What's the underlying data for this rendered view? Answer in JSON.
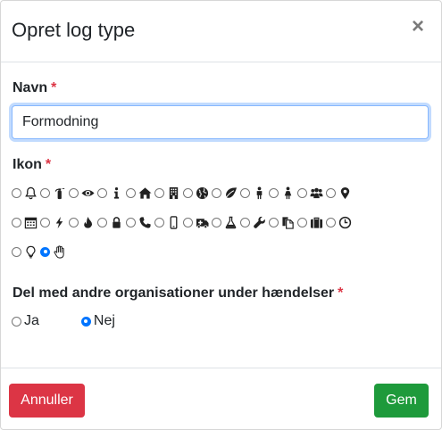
{
  "modal": {
    "title": "Opret log type",
    "close_label": "×"
  },
  "form": {
    "name_label": "Navn",
    "name_value": "Formodning",
    "icon_label": "Ikon",
    "required_mark": "*",
    "share_label": "Del med andre organisationer under hændelser",
    "share_options": [
      {
        "label": "Ja",
        "selected": false
      },
      {
        "label": "Nej",
        "selected": true
      }
    ]
  },
  "icons": [
    {
      "name": "bell-icon",
      "selected": false
    },
    {
      "name": "fire-extinguisher-icon",
      "selected": false
    },
    {
      "name": "eye-icon",
      "selected": false
    },
    {
      "name": "info-icon",
      "selected": false
    },
    {
      "name": "home-icon",
      "selected": false
    },
    {
      "name": "building-icon",
      "selected": false
    },
    {
      "name": "globe-icon",
      "selected": false
    },
    {
      "name": "leaf-icon",
      "selected": false
    },
    {
      "name": "male-icon",
      "selected": false
    },
    {
      "name": "female-icon",
      "selected": false
    },
    {
      "name": "users-icon",
      "selected": false
    },
    {
      "name": "map-marker-icon",
      "selected": false
    },
    {
      "name": "calendar-icon",
      "selected": false
    },
    {
      "name": "bolt-icon",
      "selected": false
    },
    {
      "name": "fire-icon",
      "selected": false
    },
    {
      "name": "lock-icon",
      "selected": false
    },
    {
      "name": "phone-icon",
      "selected": false
    },
    {
      "name": "mobile-icon",
      "selected": false
    },
    {
      "name": "ambulance-icon",
      "selected": false
    },
    {
      "name": "flask-icon",
      "selected": false
    },
    {
      "name": "wrench-icon",
      "selected": false
    },
    {
      "name": "copy-icon",
      "selected": false
    },
    {
      "name": "briefcase-icon",
      "selected": false
    },
    {
      "name": "clock-icon",
      "selected": false
    },
    {
      "name": "lightbulb-icon",
      "selected": false
    },
    {
      "name": "hand-paper-icon",
      "selected": true
    }
  ],
  "footer": {
    "cancel_label": "Annuller",
    "save_label": "Gem",
    "cancel_color": "#dc3545",
    "save_color": "#1e9a3b"
  }
}
